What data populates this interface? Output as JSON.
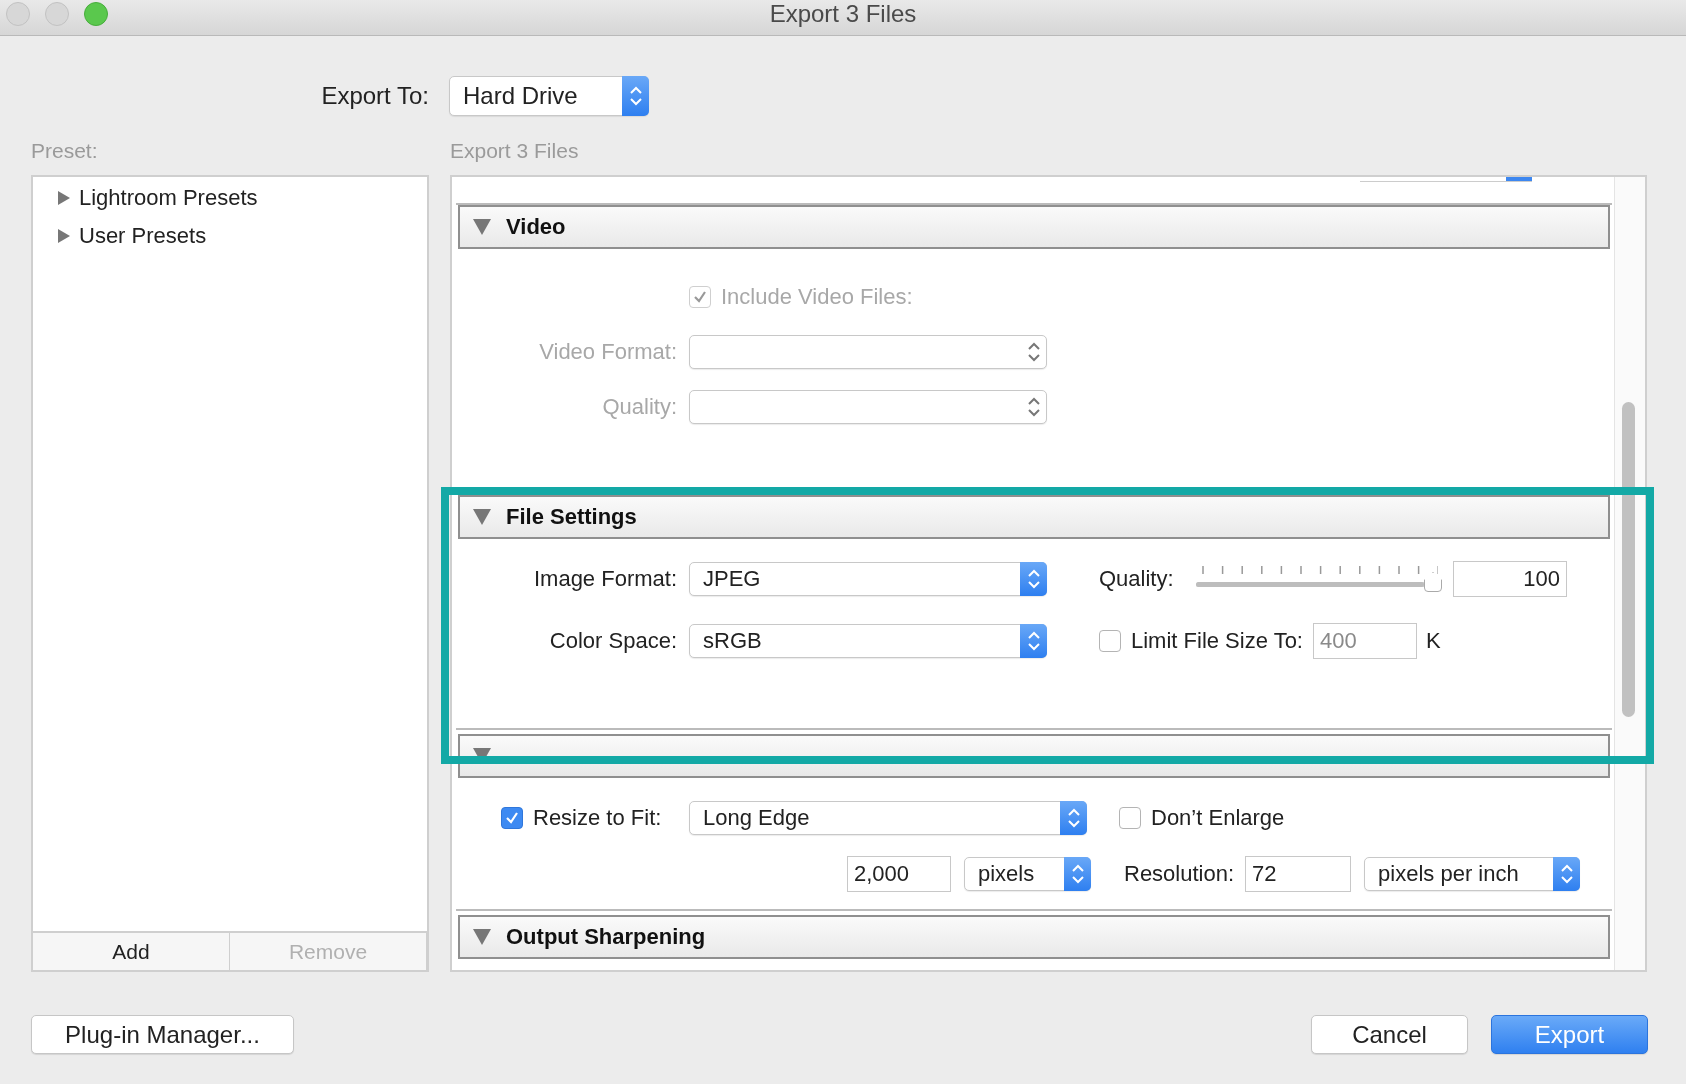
{
  "window": {
    "title": "Export 3 Files"
  },
  "export_to": {
    "label": "Export To:",
    "value": "Hard Drive"
  },
  "preset": {
    "label": "Preset:",
    "items": [
      {
        "label": "Lightroom Presets",
        "expanded": false
      },
      {
        "label": "User Presets",
        "expanded": false
      }
    ],
    "buttons": [
      {
        "label": "Add",
        "disabled": false
      },
      {
        "label": "Remove",
        "disabled": true
      }
    ]
  },
  "panel": {
    "title": "Export 3 Files",
    "sections": [
      {
        "kind": "video",
        "title": "Video",
        "expanded": true,
        "include": {
          "label": "Include Video Files:",
          "checked": true,
          "disabled": true
        },
        "format": {
          "label": "Video Format:",
          "disabled": true
        },
        "quality": {
          "label": "Quality:",
          "disabled": true
        }
      },
      {
        "kind": "file_settings",
        "title": "File Settings",
        "expanded": true,
        "image_format": {
          "label": "Image Format:",
          "value": "JPEG"
        },
        "color_space": {
          "label": "Color Space:",
          "value": "sRGB"
        },
        "quality": {
          "label": "Quality:",
          "level": 1,
          "value": "100"
        },
        "limit": {
          "label": "Limit File Size To:",
          "checked": false,
          "value": "400",
          "unit": "K"
        }
      },
      {
        "kind": "image_sizing",
        "expanded": true,
        "resize": {
          "label": "Resize to Fit:",
          "checked": true,
          "value": "Long Edge"
        },
        "dont_enlarge": {
          "label": "Don’t Enlarge",
          "checked": false
        },
        "size": {
          "value": "2,000",
          "unit": "pixels"
        },
        "resolution": {
          "label": "Resolution:",
          "value": "72",
          "unit": "pixels per inch"
        }
      },
      {
        "kind": "output_sharpening",
        "title": "Output Sharpening",
        "expanded": true
      }
    ]
  },
  "buttons": [
    {
      "label": "Plug-in Manager...",
      "default": false
    },
    {
      "label": "Cancel",
      "default": false
    },
    {
      "label": "Export",
      "default": true
    }
  ]
}
